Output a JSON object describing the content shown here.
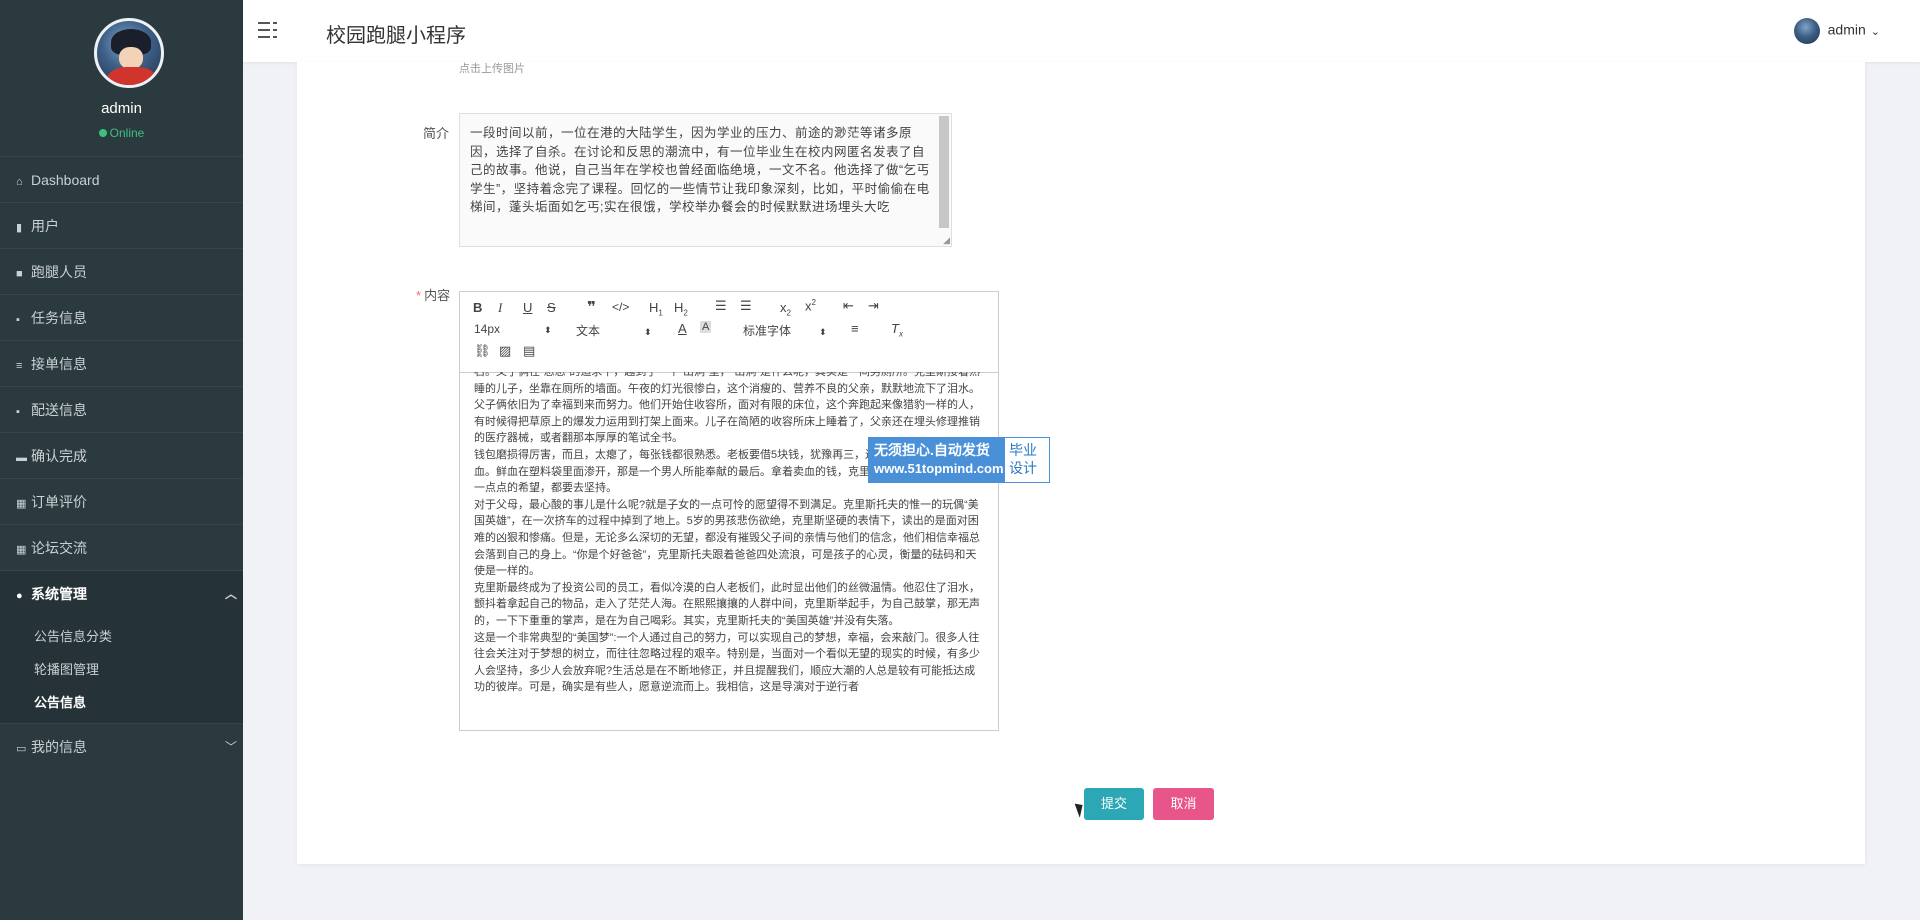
{
  "sidebar": {
    "username": "admin",
    "status": "Online",
    "items": [
      {
        "icon": "⌂",
        "label": "Dashboard"
      },
      {
        "icon": "▮",
        "label": "用户"
      },
      {
        "icon": "■",
        "label": "跑腿人员"
      },
      {
        "icon": "▪",
        "label": "任务信息"
      },
      {
        "icon": "≡",
        "label": "接单信息"
      },
      {
        "icon": "▪",
        "label": "配送信息"
      },
      {
        "icon": "▬",
        "label": "确认完成"
      },
      {
        "icon": "▦",
        "label": "订单评价"
      },
      {
        "icon": "▦",
        "label": "论坛交流"
      },
      {
        "icon": "●",
        "label": "系统管理",
        "submenu": [
          "公告信息分类",
          "轮播图管理",
          "公告信息"
        ]
      },
      {
        "icon": "▭",
        "label": "我的信息"
      }
    ]
  },
  "header": {
    "title": "校园跑腿小程序",
    "user": "admin"
  },
  "form": {
    "upload_hint": "点击上传图片",
    "intro_label": "简介",
    "intro_value": "一段时间以前，一位在港的大陆学生，因为学业的压力、前途的渺茫等诸多原因，选择了自杀。在讨论和反思的潮流中，有一位毕业生在校内网匿名发表了自己的故事。他说，自己当年在学校也曾经面临绝境，一文不名。他选择了做“乞丐学生”，坚持着念完了课程。回忆的一些情节让我印象深刻，比如，平时偷偷在电梯间，蓬头垢面如乞丐;实在很饿，学校举办餐会的时候默默进场埋头大吃",
    "content_label": "内容",
    "toolbar": {
      "size": "14px",
      "type": "文本",
      "font": "标准字体"
    },
    "content_paragraphs": [
      "石。父子俩在“忍忍”的追求下，越到了一个“山洞”里，“山洞”是什么呢，其实是一间男厕所。克里斯接着熟睡的儿子，坐靠在厕所的墙面。午夜的灯光很惨白，这个消瘦的、营养不良的父亲，默默地流下了泪水。",
      "父子俩依旧为了幸福到来而努力。他们开始住收容所，面对有限的床位，这个奔跑起来像猎豹一样的人，有时候得把草原上的爆发力运用到打架上面来。儿子在简陋的收容所床上睡着了，父亲还在埋头修理推销的医疗器械，或者翻那本厚厚的笔试全书。",
      "钱包磨损得厉害，而且，太瘪了，每张钱都很熟悉。老板要借5块钱，犹豫再三，还是把钱送了出去。卖血。鲜血在塑料袋里面渗开，那是一个男人所能奉献的最后。拿着卖血的钱，克里斯仍然去买电子元件。一点点的希望，都要去坚持。",
      "对于父母，最心酸的事儿是什么呢?就是子女的一点可怜的愿望得不到满足。克里斯托夫的惟一的玩偶“美国英雄”，在一次挤车的过程中掉到了地上。5岁的男孩悲伤欲绝，克里斯坚硬的表情下，读出的是面对困难的凶狠和惨痛。但是，无论多么深切的无望，都没有摧毁父子间的亲情与他们的信念，他们相信幸福总会落到自己的身上。“你是个好爸爸”，克里斯托夫跟着爸爸四处流浪，可是孩子的心灵，衡量的砝码和天使是一样的。",
      "克里斯最终成为了投资公司的员工，看似冷漠的白人老板们，此时显出他们的丝微温情。他忍住了泪水，颤抖着拿起自己的物品，走入了茫茫人海。在熙熙攘攘的人群中间，克里斯举起手，为自己鼓掌，那无声的，一下下重重的掌声，是在为自己喝彩。其实，克里斯托夫的“美国英雄”并没有失落。",
      "这是一个非常典型的“美国梦”:一个人通过自己的努力，可以实现自己的梦想，幸福，会来敲门。很多人往往会关注对于梦想的树立，而往往忽略过程的艰辛。特别是，当面对一个看似无望的现实的时候，有多少人会坚持，多少人会放弃呢?生活总是在不断地修正，并且提醒我们，顺应大潮的人总是较有可能抵达成功的彼岸。可是，确实是有些人，愿意逆流而上。我相信，这是导演对于逆行者"
    ],
    "submit": "提交",
    "cancel": "取消"
  },
  "watermark": {
    "line1": "无须担心.自动发货",
    "line2": "www.51topmind.com",
    "right": "毕业设计"
  }
}
